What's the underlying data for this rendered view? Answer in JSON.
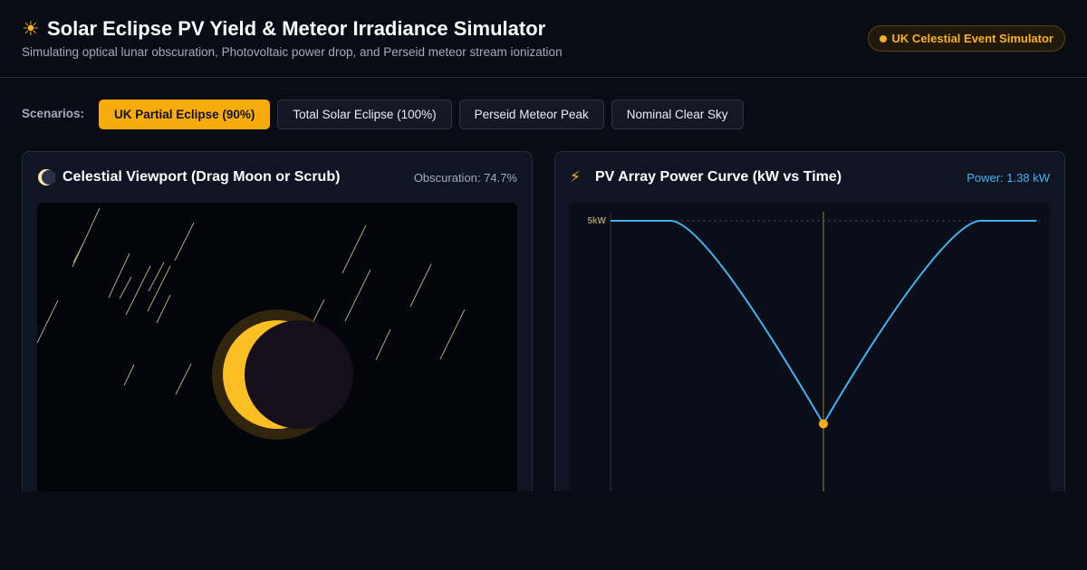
{
  "header": {
    "icon": "sun-icon",
    "title": "Solar Eclipse PV Yield & Meteor Irradiance Simulator",
    "subtitle": "Simulating optical lunar obscuration, Photovoltaic power drop, and Perseid meteor stream ionization",
    "badge": "UK Celestial Event Simulator"
  },
  "scenarios": {
    "label": "Scenarios:",
    "buttons": [
      {
        "label": "UK Partial Eclipse (90%)",
        "active": true
      },
      {
        "label": "Total Solar Eclipse (100%)",
        "active": false
      },
      {
        "label": "Perseid Meteor Peak",
        "active": false
      },
      {
        "label": "Nominal Clear Sky",
        "active": false
      }
    ]
  },
  "viewport_panel": {
    "icon": "moon-icon",
    "title": "Celestial Viewport (Drag Moon or Scrub)",
    "stat": "Obscuration: 74.7%"
  },
  "power_panel": {
    "icon": "lightning-icon",
    "title": "PV Array Power Curve (kW vs Time)",
    "stat": "Power: 1.38 kW"
  },
  "chart_data": {
    "type": "line",
    "y_tick_label": "5kW",
    "nominal_kw": 5,
    "current_kw": 1.38,
    "series": [
      {
        "x": 0,
        "y": 5
      },
      {
        "x": 0.14,
        "y": 5
      },
      {
        "x": 0.5,
        "y": 1.38
      },
      {
        "x": 0.87,
        "y": 5
      },
      {
        "x": 1,
        "y": 5
      }
    ],
    "colors": {
      "line": "#3fb6f2",
      "marker": "#f7ab0c",
      "cursor": "#6b5a22"
    }
  },
  "colors": {
    "accent": "#f7ab0c",
    "sun": "#fbbf24",
    "moon": "#150f1c"
  }
}
